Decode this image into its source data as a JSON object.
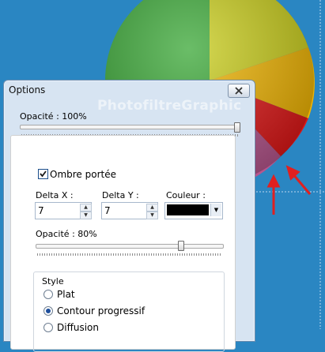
{
  "dialog": {
    "title": "Options",
    "watermark": "PhotofiltreGraphic",
    "opacity_label": "Opacité : 100%",
    "opacity_value": 100
  },
  "shadow": {
    "checkbox_label": "Ombre portée",
    "checked": true,
    "delta_x_label": "Delta X :",
    "delta_x_value": "7",
    "delta_y_label": "Delta Y :",
    "delta_y_value": "7",
    "color_label": "Couleur :",
    "color_value": "#000000",
    "opacity_label": "Opacité : 80%",
    "opacity_value": 80
  },
  "style": {
    "group_label": "Style",
    "options": [
      {
        "label": "Plat",
        "selected": false
      },
      {
        "label": "Contour progressif",
        "selected": true
      },
      {
        "label": "Diffusion",
        "selected": false
      }
    ]
  },
  "colors": {
    "arrow": "#e02020",
    "background": "#2a86c2"
  }
}
